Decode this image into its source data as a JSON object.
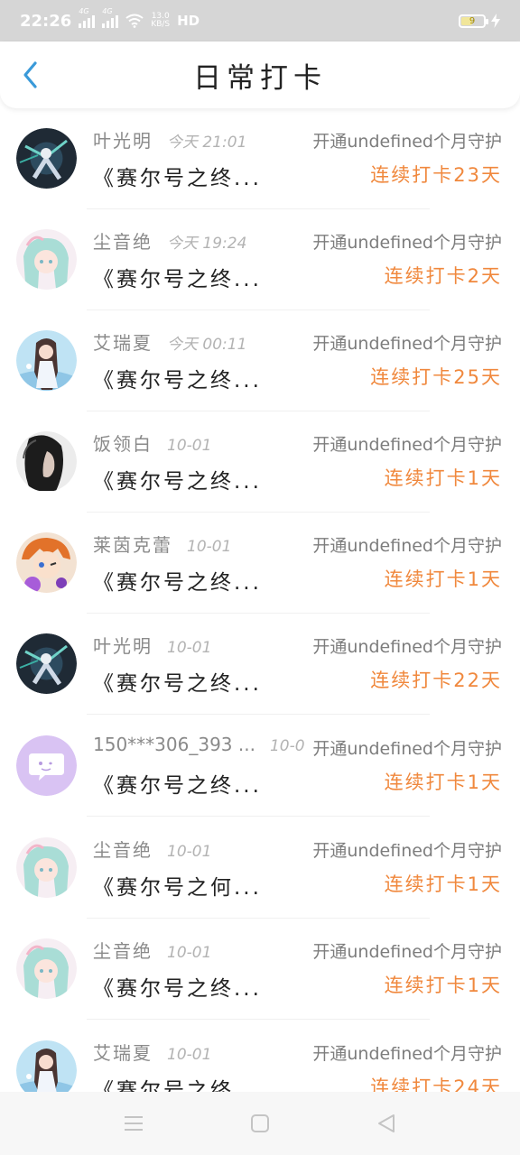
{
  "status_bar": {
    "time": "22:26",
    "signal_1_tag": "4G",
    "signal_2_tag": "4G",
    "speed_value": "13.0",
    "speed_unit": "KB/S",
    "hd": "HD",
    "battery": "9"
  },
  "header": {
    "title": "日常打卡",
    "back_icon": "chevron-left-icon"
  },
  "checkins": [
    {
      "name": "叶光明",
      "time": "今天 21:01",
      "guard": "开通undefined个月守护",
      "title": "《赛尔号之终...",
      "streak": "连续打卡23天",
      "avatar": "mecha-robot"
    },
    {
      "name": "尘音绝",
      "time": "今天 19:24",
      "guard": "开通undefined个月守护",
      "title": "《赛尔号之终...",
      "streak": "连续打卡2天",
      "avatar": "anime-girl-teal"
    },
    {
      "name": "艾瑞夏",
      "time": "今天 00:11",
      "guard": "开通undefined个月守护",
      "title": "《赛尔号之终...",
      "streak": "连续打卡25天",
      "avatar": "anime-girl-blue"
    },
    {
      "name": "饭领白",
      "time": "10-01",
      "guard": "开通undefined个月守护",
      "title": "《赛尔号之终...",
      "streak": "连续打卡1天",
      "avatar": "dark-portrait"
    },
    {
      "name": "莱茵克蕾",
      "time": "10-01",
      "guard": "开通undefined个月守护",
      "title": "《赛尔号之终...",
      "streak": "连续打卡1天",
      "avatar": "anime-boy-orange"
    },
    {
      "name": "叶光明",
      "time": "10-01",
      "guard": "开通undefined个月守护",
      "title": "《赛尔号之终...",
      "streak": "连续打卡22天",
      "avatar": "mecha-robot"
    },
    {
      "name": "150***306_393 ...",
      "time": "10-0",
      "guard": "开通undefined个月守护",
      "title": "《赛尔号之终...",
      "streak": "连续打卡1天",
      "avatar": "default-chat"
    },
    {
      "name": "尘音绝",
      "time": "10-01",
      "guard": "开通undefined个月守护",
      "title": "《赛尔号之何...",
      "streak": "连续打卡1天",
      "avatar": "anime-girl-teal"
    },
    {
      "name": "尘音绝",
      "time": "10-01",
      "guard": "开通undefined个月守护",
      "title": "《赛尔号之终...",
      "streak": "连续打卡1天",
      "avatar": "anime-girl-teal"
    },
    {
      "name": "艾瑞夏",
      "time": "10-01",
      "guard": "开通undefined个月守护",
      "title": "《赛尔号之终...",
      "streak": "连续打卡24天",
      "avatar": "anime-girl-blue"
    }
  ],
  "nav_bar": {
    "menu_icon": "menu-icon",
    "home_icon": "home-icon",
    "back_icon": "back-triangle-icon"
  },
  "colors": {
    "accent_back": "#3a9ad9",
    "streak": "#f0883d",
    "status_bar_bg": "#d6d6d6",
    "default_avatar": "#d9c3f3"
  }
}
